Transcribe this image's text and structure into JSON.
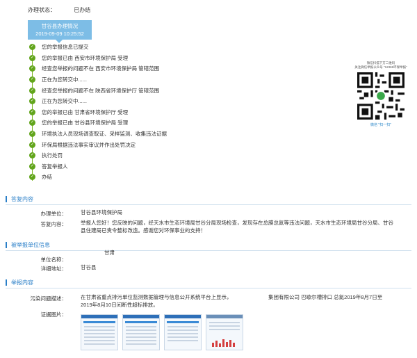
{
  "status": {
    "label": "办理状态：",
    "value": "已办结"
  },
  "badge": {
    "title": "甘谷县办理情况",
    "time": "2019-09-09 10:25:52"
  },
  "timeline": [
    "您的举报信息已提交",
    "您的举报已由 西安市环境保护局 受理",
    "经查您举报的问题不在 西安市环境保护局 管辖范围",
    "正在为您转交中......",
    "经查您举报的问题不在 陕西省环境保护厅 管辖范围",
    "正在为您转交中......",
    "您的举报已由 甘肃省环境保护厅 受理",
    "您的举报已由 甘谷县环境保护局 受理",
    "环境执法人员现场调查取证、采样监测、收集违法证据",
    "环保局根据违法事实审议并作出处罚决定",
    "执行处罚",
    "答复举报人",
    "办结"
  ],
  "qr": {
    "caption_1": "微信扫描下方二维码",
    "caption_2": "关注微信举报公众号 \"12369环保举报\"",
    "scan_text": "微信 \"扫一扫\""
  },
  "reply": {
    "section_title": "答复内容",
    "unit_label": "办理单位：",
    "unit_value": "甘谷县环境保护局",
    "content_label": "答复内容：",
    "content_value": "举报人您好！您反映的问题，经天水市生态环境局甘谷分局现场检查，发现存在总膜总氮等违法问题，天水市生态环境局甘谷分局、甘谷县住建局已责令整标改造。感谢您对环保事业的支持！"
  },
  "reported_unit": {
    "section_title": "被举报单位信息",
    "name_label": "单位名称：",
    "name_value": "甘肃",
    "addr_label": "详细地址：",
    "addr_value": "甘谷县"
  },
  "report": {
    "section_title": "举报内容",
    "desc_label": "污染问题描述：",
    "desc_line1_a": "在甘肃省重点排污单位监测数据管理与信息公开系统平台上显示，",
    "desc_line1_b": "集团有限公司 巴歇尔槽排口 总氮2019年8月7日至",
    "desc_line2": "2019年8月10日间断性超标排放。",
    "evidence_label": "证据图片："
  },
  "icons": {
    "timeline_check": "check-icon"
  },
  "colors": {
    "accent": "#2a7fc8",
    "badge": "#7dbde6",
    "check": "#62a51c"
  }
}
